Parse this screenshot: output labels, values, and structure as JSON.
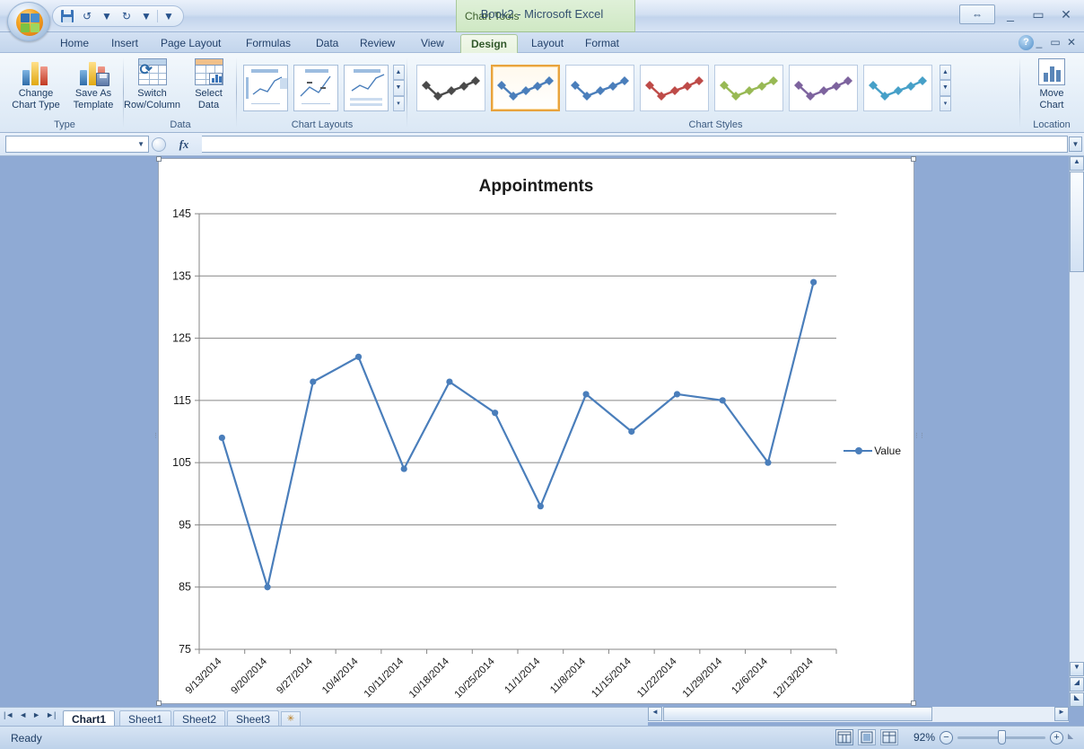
{
  "window": {
    "title": "Book2 - Microsoft Excel",
    "context_tab_group": "Chart Tools",
    "quick_access": [
      "save-icon",
      "undo-icon",
      "redo-icon",
      "customize-icon"
    ],
    "buttons": {
      "restore_ribbon": "restore-icon",
      "minimize": "_",
      "maximize": "▭",
      "close": "✕"
    },
    "help": "?"
  },
  "tabs": [
    {
      "label": "Home",
      "active": false
    },
    {
      "label": "Insert",
      "active": false
    },
    {
      "label": "Page Layout",
      "active": false
    },
    {
      "label": "Formulas",
      "active": false
    },
    {
      "label": "Data",
      "active": false
    },
    {
      "label": "Review",
      "active": false
    },
    {
      "label": "View",
      "active": false
    },
    {
      "label": "Design",
      "active": true
    },
    {
      "label": "Layout",
      "active": false
    },
    {
      "label": "Format",
      "active": false
    }
  ],
  "ribbon": {
    "groups": [
      {
        "name": "Type",
        "label": "Type"
      },
      {
        "name": "Data",
        "label": "Data"
      },
      {
        "name": "Chart Layouts",
        "label": "Chart Layouts"
      },
      {
        "name": "Chart Styles",
        "label": "Chart Styles"
      },
      {
        "name": "Location",
        "label": "Location"
      }
    ],
    "type_group": {
      "change_chart_type": "Change\nChart Type",
      "change_chart_type_l1": "Change",
      "change_chart_type_l2": "Chart Type",
      "save_as_template_l1": "Save As",
      "save_as_template_l2": "Template"
    },
    "data_group": {
      "switch_row_column_l1": "Switch",
      "switch_row_column_l2": "Row/Column",
      "select_data_l1": "Select",
      "select_data_l2": "Data"
    },
    "location_group": {
      "move_chart_l1": "Move",
      "move_chart_l2": "Chart"
    },
    "chart_styles": {
      "selected_index": 1,
      "colors": [
        "#4a4a4a",
        "#4a7ebb",
        "#4a7ebb",
        "#be4b48",
        "#98b954",
        "#7d639e",
        "#46a0c8"
      ]
    }
  },
  "formula_bar": {
    "name_box_value": "",
    "formula_value": "",
    "fx_label": "fx"
  },
  "sheet_tabs": {
    "items": [
      {
        "label": "Chart1",
        "active": true
      },
      {
        "label": "Sheet1",
        "active": false
      },
      {
        "label": "Sheet2",
        "active": false
      },
      {
        "label": "Sheet3",
        "active": false
      }
    ],
    "new_sheet_icon": "new-sheet-icon"
  },
  "status_bar": {
    "message": "Ready",
    "zoom_level": "92%",
    "zoom_out": "−",
    "zoom_in": "+",
    "views": [
      "normal-view-icon",
      "page-layout-view-icon",
      "page-break-view-icon"
    ]
  },
  "chart_data": {
    "type": "line",
    "title": "Appointments",
    "xlabel": "",
    "ylabel": "",
    "ylim": [
      75,
      145
    ],
    "ytick_step": 10,
    "yticks": [
      75,
      85,
      95,
      105,
      115,
      125,
      135,
      145
    ],
    "grid": true,
    "legend_position": "right",
    "series_color": "#4a7ebb",
    "categories": [
      "9/13/2014",
      "9/20/2014",
      "9/27/2014",
      "10/4/2014",
      "10/11/2014",
      "10/18/2014",
      "10/25/2014",
      "11/1/2014",
      "11/8/2014",
      "11/15/2014",
      "11/22/2014",
      "11/29/2014",
      "12/6/2014",
      "12/13/2014"
    ],
    "series": [
      {
        "name": "Value",
        "values": [
          109,
          85,
          118,
          122,
          104,
          118,
          113,
          98,
          116,
          110,
          116,
          115,
          105,
          134
        ]
      }
    ]
  }
}
